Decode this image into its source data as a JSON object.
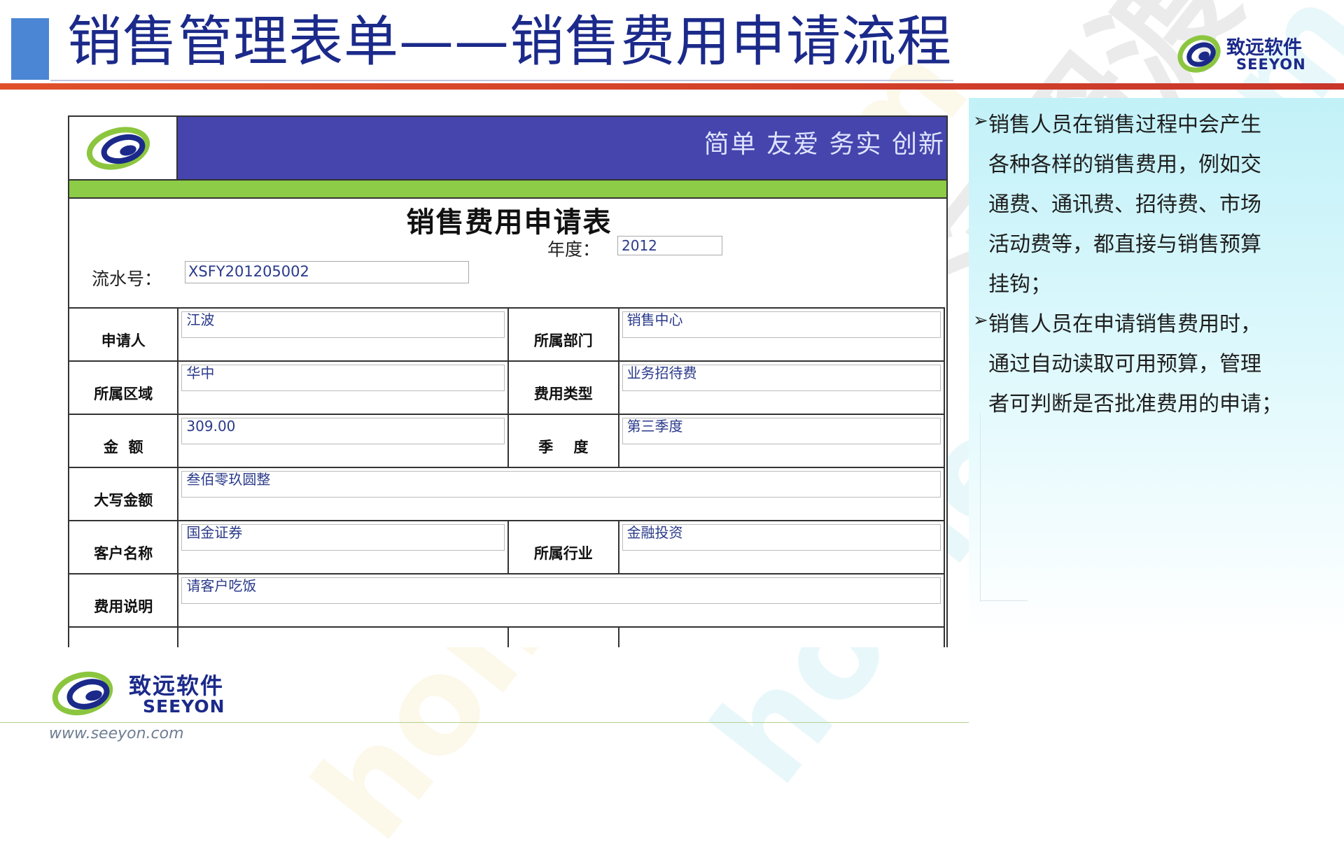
{
  "header": {
    "title": "销售管理表单——销售费用申请流程",
    "logo_cn": "致远软件",
    "logo_en": "SEEYON"
  },
  "watermark": {
    "text1": "homedo.com",
    "text2": "河姆渡"
  },
  "form": {
    "slogan": "简单  友爱  务实  创新",
    "heading": "销售费用申请表",
    "year_label": "年度：",
    "year_value": "2012",
    "serial_label": "流水号：",
    "serial_value": "XSFY201205002",
    "rows": {
      "applicant_label": "申请人",
      "applicant_value": "江波",
      "dept_label": "所属部门",
      "dept_value": "销售中心",
      "region_label": "所属区域",
      "region_value": "华中",
      "fee_type_label": "费用类型",
      "fee_type_value": "业务招待费",
      "amount_label": "金  额",
      "amount_value": "309.00",
      "quarter_label": "季    度",
      "quarter_value": "第三季度",
      "amount_upper_label": "大写金额",
      "amount_upper_value": "叁佰零玖圆整",
      "customer_label": "客户名称",
      "customer_value": "国金证券",
      "industry_label": "所属行业",
      "industry_value": "金融投资",
      "fee_desc_label": "费用说明",
      "fee_desc_value": "请客户吃饭"
    }
  },
  "panel": {
    "bullet1_lines": [
      "销售人员在销售过程中会产生",
      "各种各样的销售费用，例如交",
      "通费、通讯费、招待费、市场",
      "活动费等，都直接与销售预算",
      "挂钩；"
    ],
    "bullet2_lines": [
      "销售人员在申请销售费用时，",
      "通过自动读取可用预算，管理",
      "者可判断是否批准费用的申请；"
    ],
    "arrow_glyph": "➢"
  },
  "footer": {
    "logo_cn": "致远软件",
    "logo_en": "SEEYON",
    "url": "www.seeyon.com"
  },
  "colors": {
    "title": "#1b2a8a",
    "title_square": "#4a86d4",
    "red_line": "#d9432a",
    "banner": "#4545ad",
    "green_bar": "#8ccc46",
    "panel_bg": "#c2f1f8"
  }
}
